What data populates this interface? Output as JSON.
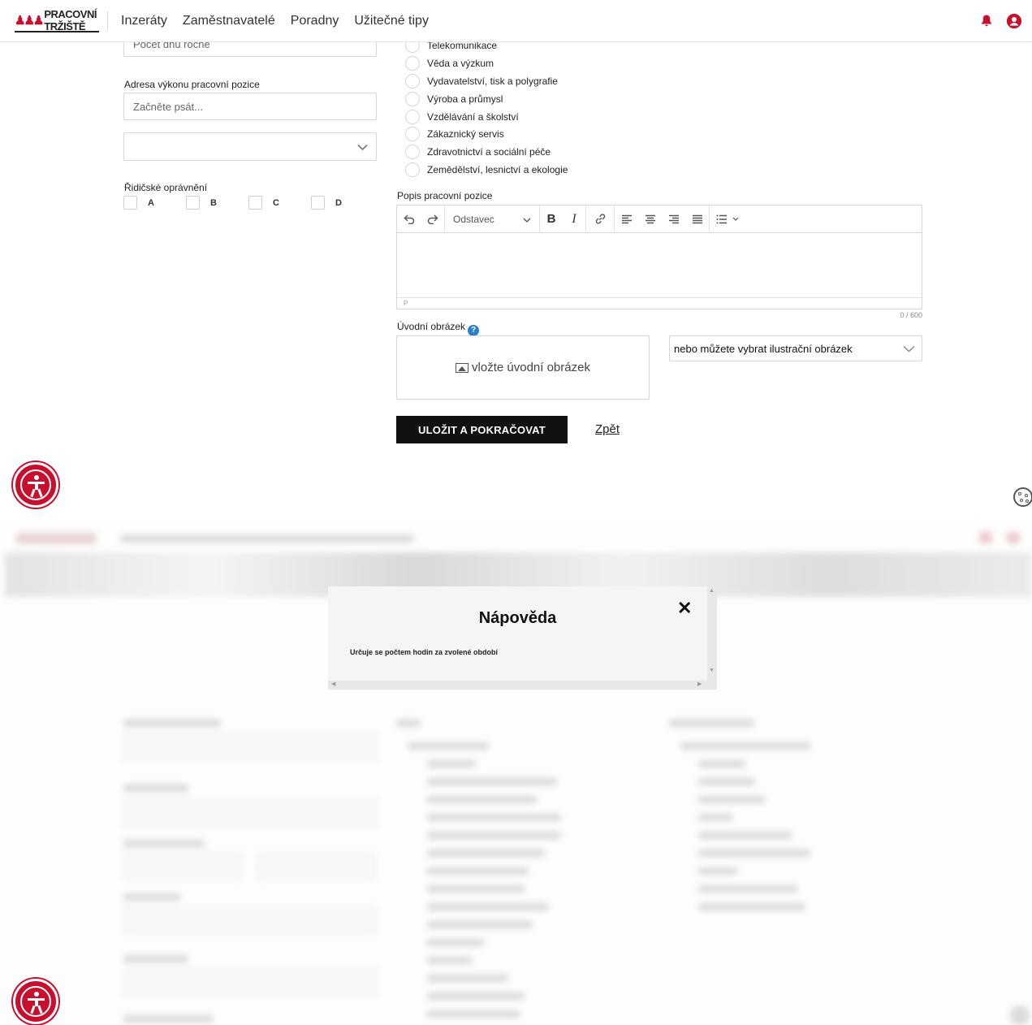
{
  "header": {
    "logo_text": "PRACOVNÍ TRŽIŠTĚ",
    "nav": [
      "Inzeráty",
      "Zaměstnavatelé",
      "Poradny",
      "Užitečné tipy"
    ],
    "bell_icon": "bell-icon",
    "user_icon": "user-icon",
    "accent_color": "#c8102e"
  },
  "form": {
    "days_placeholder": "Počet dnů ročně",
    "address_label": "Adresa výkonu pracovní pozice",
    "address_placeholder": "Začněte psát...",
    "license_label": "Řidičské oprávnění",
    "license_options": [
      "A",
      "B",
      "C",
      "D"
    ],
    "sectors": [
      "Telekomunikace",
      "Věda a výzkum",
      "Vydavatelství, tisk a polygrafie",
      "Výroba a průmysl",
      "Vzdělávání a školství",
      "Zákaznický servis",
      "Zdravotnictví a sociální péče",
      "Zemědělství, lesnictví a ekologie"
    ],
    "description_label": "Popis pracovní pozice",
    "editor": {
      "paragraph_select": "Odstavec",
      "bold": "B",
      "italic": "I",
      "status": "P",
      "counter": "0 / 600"
    },
    "intro_image_label": "Úvodní obrázek",
    "help_mark": "?",
    "upload_text": "vložte úvodní obrázek",
    "illustration_select": "nebo můžete vybrat ilustrační obrázek",
    "save_button": "ULOŽIT A POKRAČOVAT",
    "back_link": "Zpět"
  },
  "modal": {
    "title": "Nápověda",
    "close": "✕",
    "text": "Určuje se počtem hodin za zvolené období"
  }
}
